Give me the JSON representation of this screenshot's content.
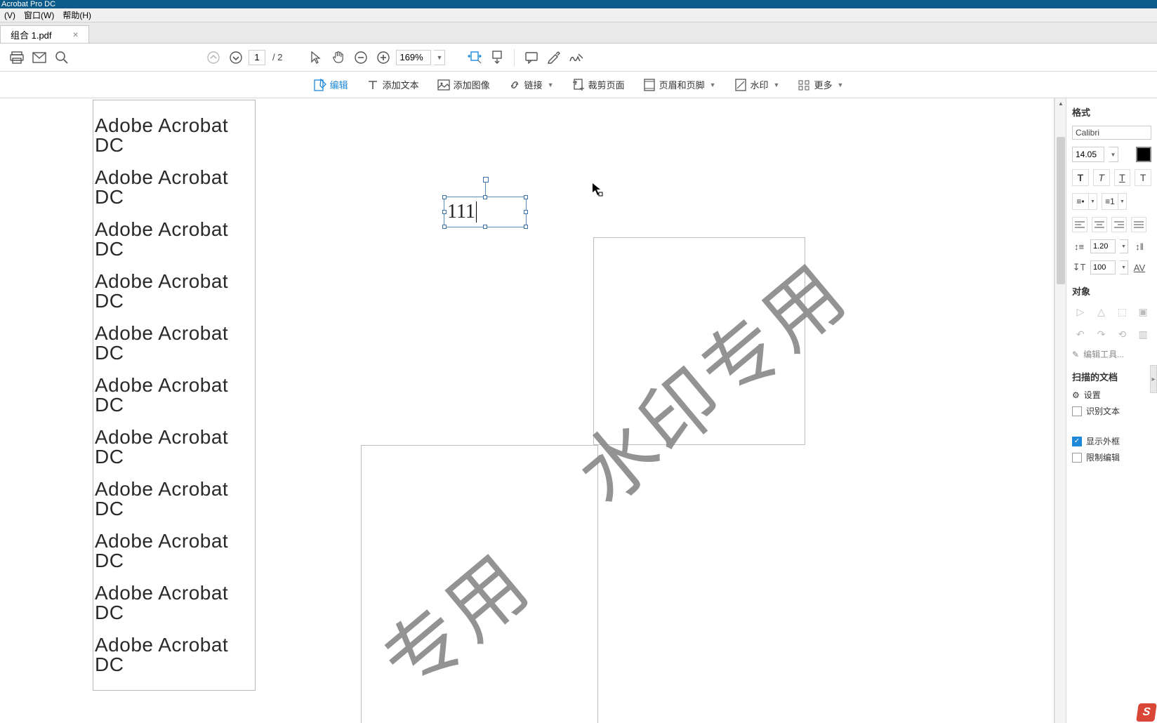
{
  "titlebar": {
    "app_name": "Acrobat Pro DC"
  },
  "menubar": {
    "view": "(V)",
    "window": "窗口(W)",
    "help": "帮助(H)"
  },
  "tab": {
    "label": "组合 1.pdf",
    "close": "×"
  },
  "toolbar": {
    "current_page": "1",
    "total_pages": "/ 2",
    "zoom": "169%"
  },
  "edit_toolbar": {
    "edit": "编辑",
    "add_text": "添加文本",
    "add_image": "添加图像",
    "link": "链接",
    "crop": "裁剪页面",
    "header_footer": "页眉和页脚",
    "watermark": "水印",
    "more": "更多"
  },
  "document": {
    "repeated_text": "Adobe Acrobat DC",
    "lines": [
      "Adobe Acrobat DC",
      "Adobe Acrobat DC",
      "Adobe Acrobat DC",
      "Adobe Acrobat DC",
      "Adobe Acrobat DC",
      "Adobe Acrobat DC",
      "Adobe Acrobat DC",
      "Adobe Acrobat DC",
      "Adobe Acrobat DC",
      "Adobe Acrobat DC",
      "Adobe Acrobat DC"
    ],
    "selected_text": "111",
    "watermark1": "水印专用",
    "watermark2": "专用"
  },
  "format_panel": {
    "title": "格式",
    "font": "Calibri",
    "font_size": "14.05",
    "line_spacing": "1.20",
    "char_scaling": "100",
    "object_title": "对象",
    "edit_tools": "编辑工具...",
    "scanned_title": "扫描的文档",
    "settings": "设置",
    "recognize_text": "识别文本",
    "show_boxes": "显示外框",
    "restrict_edit": "限制编辑"
  },
  "tray": {
    "letter": "S"
  }
}
